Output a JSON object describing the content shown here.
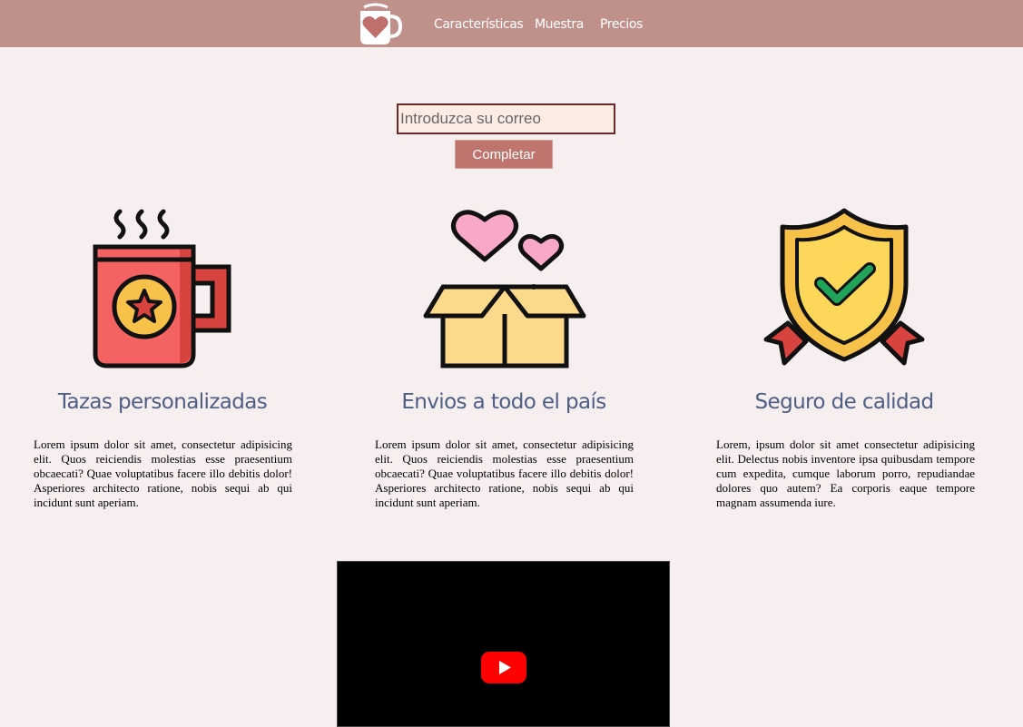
{
  "nav": {
    "items": [
      "Características",
      "Muestra",
      "Precios"
    ]
  },
  "signup": {
    "email_placeholder": "Introduzca su correo",
    "submit_label": "Completar"
  },
  "features": [
    {
      "icon": "mug-star-icon",
      "title": "Tazas personalizadas",
      "text": "Lorem ipsum dolor sit amet, consectetur adipisicing elit. Quos reiciendis molestias esse praesentium obcaecati? Quae voluptatibus facere illo debitis dolor! Asperiores architecto ratione, nobis sequi ab qui incidunt sunt aperiam."
    },
    {
      "icon": "gift-box-hearts-icon",
      "title": "Envios a todo el país",
      "text": "Lorem ipsum dolor sit amet, consectetur adipisicing elit. Quos reiciendis molestias esse praesentium obcaecati? Quae voluptatibus facere illo debitis dolor! Asperiores architecto ratione, nobis sequi ab qui incidunt sunt aperiam."
    },
    {
      "icon": "shield-check-icon",
      "title": "Seguro de calidad",
      "text": "Lorem, ipsum dolor sit amet consectetur adipisicing elit. Delectus nobis inventore ipsa quibusdam tempore cum expedita, cumque laborum porro, repudiandae dolores quo autem? Ea corporis eaque tempore magnam assumenda iure."
    }
  ],
  "colors": {
    "header": "#c0908a",
    "background": "#f6eeef",
    "button": "#bf756d",
    "title": "#4d5f85"
  }
}
